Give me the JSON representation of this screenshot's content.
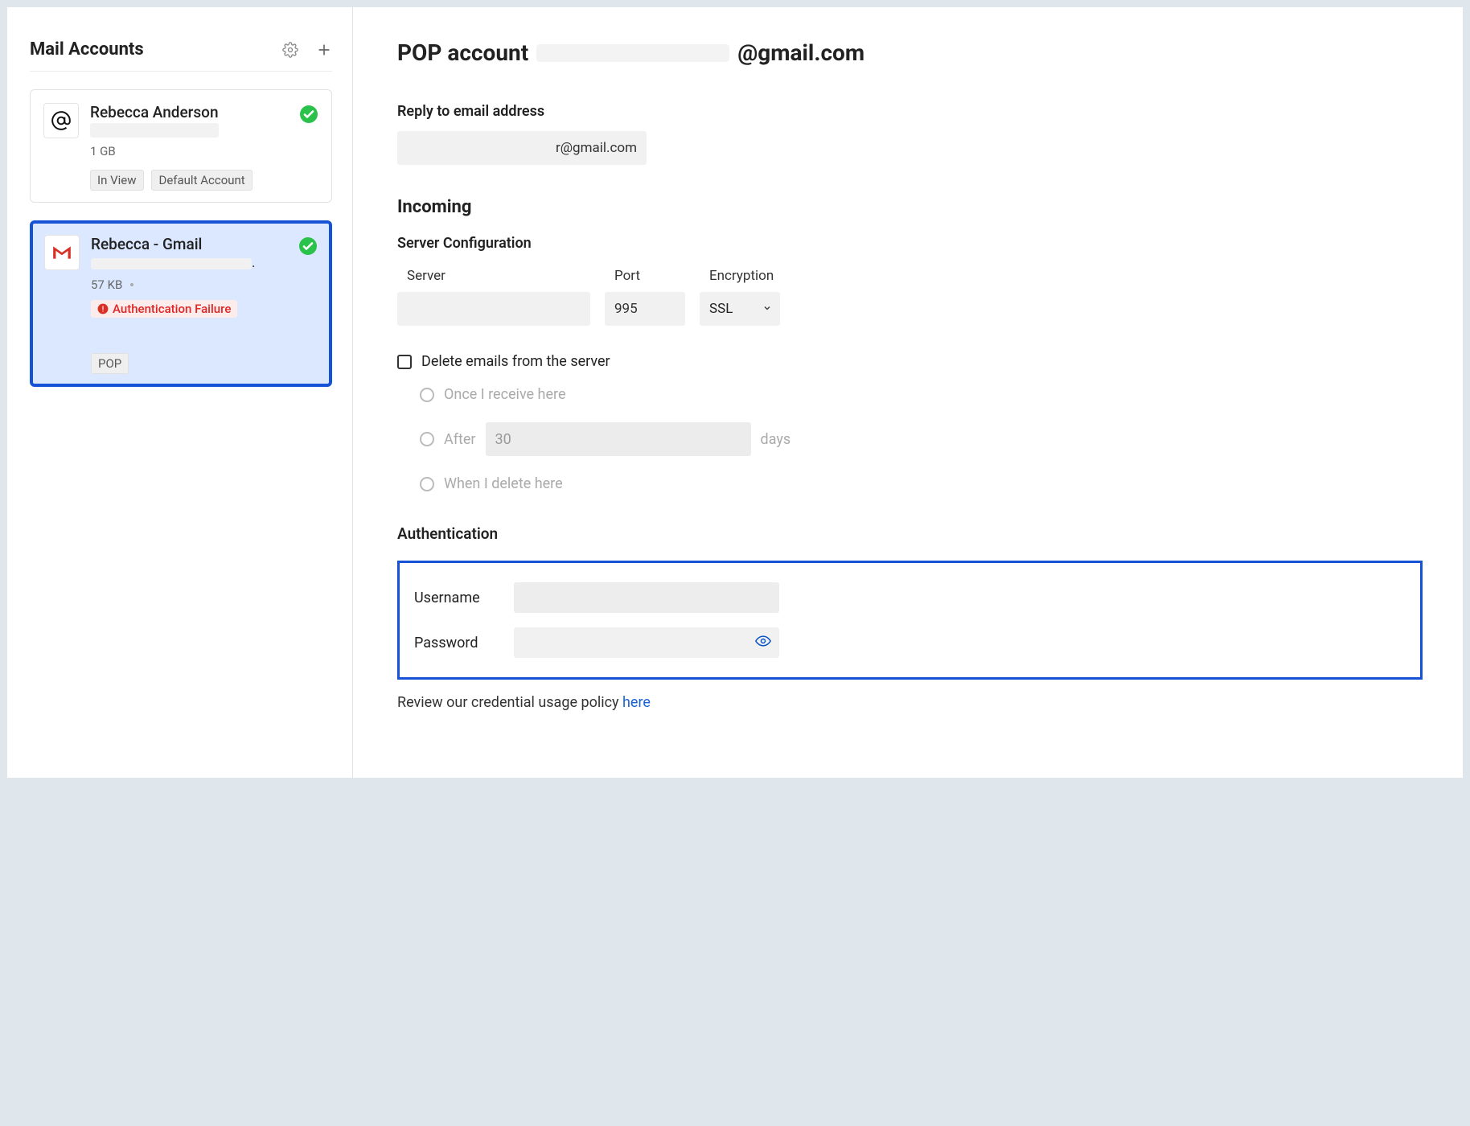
{
  "sidebar": {
    "title": "Mail Accounts",
    "accounts": [
      {
        "name": "Rebecca Anderson",
        "size": "1 GB",
        "tags": [
          "In View",
          "Default Account"
        ],
        "status": "ok",
        "icon": "at"
      },
      {
        "name": "Rebecca - Gmail",
        "email_suffix": ".",
        "size": "57 KB",
        "error": "Authentication Failure",
        "tags": [
          "POP"
        ],
        "status": "ok",
        "icon": "gmail",
        "selected": true
      }
    ]
  },
  "main": {
    "title_prefix": "POP account",
    "title_suffix": "@gmail.com",
    "reply_to": {
      "label": "Reply to email address",
      "value_suffix": "r@gmail.com"
    },
    "incoming": {
      "title": "Incoming",
      "config_label": "Server Configuration",
      "server_label": "Server",
      "server_value": "",
      "port_label": "Port",
      "port_value": "995",
      "encryption_label": "Encryption",
      "encryption_value": "SSL",
      "delete_label": "Delete emails from the server",
      "radio_once": "Once I receive here",
      "radio_after_prefix": "After",
      "radio_after_value": "30",
      "radio_after_suffix": "days",
      "radio_delete": "When I delete here"
    },
    "auth": {
      "title": "Authentication",
      "username_label": "Username",
      "password_label": "Password"
    },
    "policy_text": "Review our credential usage policy ",
    "policy_link": "here"
  }
}
